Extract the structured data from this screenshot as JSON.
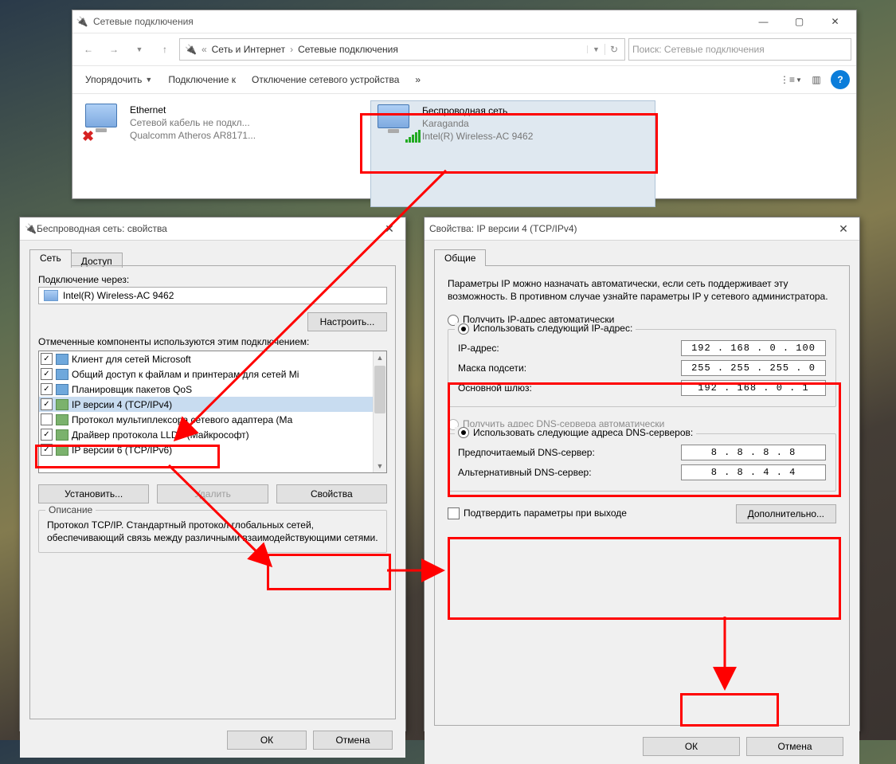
{
  "explorer": {
    "title": "Сетевые подключения",
    "breadcrumb": {
      "b1": "Сеть и Интернет",
      "b2": "Сетевые подключения"
    },
    "search_placeholder": "Поиск: Сетевые подключения",
    "cmd": {
      "organize": "Упорядочить",
      "connect": "Подключение к",
      "disable": "Отключение сетевого устройства",
      "more": "»"
    },
    "items": [
      {
        "name": "Ethernet",
        "l2": "Сетевой кабель не подкл...",
        "l3": "Qualcomm Atheros AR8171..."
      },
      {
        "name": "Беспроводная сеть",
        "l2": "Karaganda",
        "l3": "Intel(R) Wireless-AC 9462"
      }
    ]
  },
  "props": {
    "title": "Беспроводная сеть: свойства",
    "tabs": {
      "net": "Сеть",
      "access": "Доступ"
    },
    "connect_via": "Подключение через:",
    "adapter": "Intel(R) Wireless-AC 9462",
    "configure": "Настроить...",
    "components_label": "Отмеченные компоненты используются этим подключением:",
    "components": [
      "Клиент для сетей Microsoft",
      "Общий доступ к файлам и принтерам для сетей Mi",
      "Планировщик пакетов QoS",
      "IP версии 4 (TCP/IPv4)",
      "Протокол мультиплексора сетевого адаптера (Ма",
      "Драйвер протокола LLDP (Майкрософт)",
      "IP версии 6 (TCP/IPv6)"
    ],
    "install": "Установить...",
    "remove": "Удалить",
    "properties": "Свойства",
    "desc_title": "Описание",
    "desc": "Протокол TCP/IP. Стандартный протокол глобальных сетей, обеспечивающий связь между различными взаимодействующими сетями.",
    "ok": "ОК",
    "cancel": "Отмена"
  },
  "ipv4": {
    "title": "Свойства: IP версии 4 (TCP/IPv4)",
    "tab": "Общие",
    "intro": "Параметры IP можно назначать автоматически, если сеть поддерживает эту возможность. В противном случае узнайте параметры IP у сетевого администратора.",
    "r_auto_ip": "Получить IP-адрес автоматически",
    "r_use_ip": "Использовать следующий IP-адрес:",
    "ip_lbl": "IP-адрес:",
    "mask_lbl": "Маска подсети:",
    "gw_lbl": "Основной шлюз:",
    "ip": "192 . 168 .  0  . 100",
    "mask": "255 . 255 . 255 .  0",
    "gw": "192 . 168 .  0  .  1",
    "r_auto_dns": "Получить адрес DNS-сервера автоматически",
    "r_use_dns": "Использовать следующие адреса DNS-серверов:",
    "dns1_lbl": "Предпочитаемый DNS-сервер:",
    "dns2_lbl": "Альтернативный DNS-сервер:",
    "dns1": "8  .  8  .  8  .  8",
    "dns2": "8  .  8  .  4  .  4",
    "confirm": "Подтвердить параметры при выходе",
    "advanced": "Дополнительно...",
    "ok": "ОК",
    "cancel": "Отмена"
  }
}
